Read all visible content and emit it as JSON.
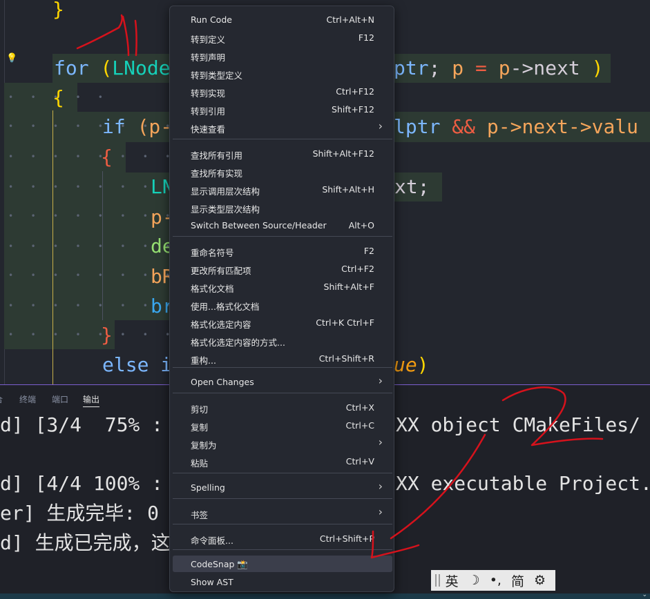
{
  "editor": {
    "lines": {
      "l0": "}",
      "l1a": "for",
      "l1b": "(",
      "l1c": "LNode",
      "l1d": "ptr",
      "l1e": ";",
      "l1f": "p",
      "l1g": "=",
      "l1h": "p",
      "l1i": "->next",
      "l1j": ")",
      "l2": "{",
      "l3a": "if",
      "l3b": "(p-",
      "l3c": "lptr",
      "l3d": "&&",
      "l3e": "p->next->valu",
      "l4": "{",
      "l5a": "LN",
      "l5b": "xt;",
      "l6": "p-",
      "l7": "de",
      "l8": "bR",
      "l9": "br",
      "l10": "}",
      "l11a": "else i",
      "l11b": "ue",
      "l11c": ")"
    }
  },
  "panel": {
    "tabs": [
      "合",
      "终端",
      "端口",
      "输出"
    ],
    "active_tab": "输出",
    "output": {
      "o1a": "d] [3/4  75% :",
      "o1b": "XX object CMakeFiles/",
      "o2a": "d] [4/4 100% :",
      "o2b": "XX executable Project.",
      "o3a": "er] 生成完毕: 0",
      "o4a": "d] 生成已完成，这"
    }
  },
  "ime": {
    "items": [
      "英",
      "☽",
      "•,",
      "简",
      "⚙"
    ]
  },
  "menu": {
    "groups": [
      [
        {
          "label": "Run Code",
          "key": "Ctrl+Alt+N"
        },
        {
          "label": "转到定义",
          "key": "F12"
        },
        {
          "label": "转到声明",
          "key": ""
        },
        {
          "label": "转到类型定义",
          "key": ""
        },
        {
          "label": "转到实现",
          "key": "Ctrl+F12"
        },
        {
          "label": "转到引用",
          "key": "Shift+F12"
        },
        {
          "label": "快速查看",
          "key": "",
          "submenu": true
        }
      ],
      [
        {
          "label": "查找所有引用",
          "key": "Shift+Alt+F12"
        },
        {
          "label": "查找所有实现",
          "key": ""
        },
        {
          "label": "显示调用层次结构",
          "key": "Shift+Alt+H"
        },
        {
          "label": "显示类型层次结构",
          "key": ""
        },
        {
          "label": "Switch Between Source/Header",
          "key": "Alt+O"
        }
      ],
      [
        {
          "label": "重命名符号",
          "key": "F2"
        },
        {
          "label": "更改所有匹配项",
          "key": "Ctrl+F2"
        },
        {
          "label": "格式化文档",
          "key": "Shift+Alt+F"
        },
        {
          "label": "使用...格式化文档",
          "key": ""
        },
        {
          "label": "格式化选定内容",
          "key": "Ctrl+K Ctrl+F"
        },
        {
          "label": "格式化选定内容的方式...",
          "key": ""
        },
        {
          "label": "重构...",
          "key": "Ctrl+Shift+R"
        }
      ],
      [
        {
          "label": "Open Changes",
          "key": "",
          "submenu": true
        }
      ],
      [
        {
          "label": "剪切",
          "key": "Ctrl+X"
        },
        {
          "label": "复制",
          "key": "Ctrl+C"
        },
        {
          "label": "复制为",
          "key": "",
          "submenu": true
        },
        {
          "label": "粘贴",
          "key": "Ctrl+V"
        }
      ],
      [
        {
          "label": "Spelling",
          "key": "",
          "submenu": true
        }
      ],
      [
        {
          "label": "书签",
          "key": "",
          "submenu": true
        }
      ],
      [
        {
          "label": "命令面板...",
          "key": "Ctrl+Shift+P"
        }
      ],
      [
        {
          "label": "CodeSnap 📸",
          "key": "",
          "hover": true
        },
        {
          "label": "Show AST",
          "key": ""
        }
      ]
    ]
  },
  "colors": {
    "menu_bg": "#252830",
    "editor_bg": "#23262e",
    "selection_bg": "#2d3a33",
    "annotation_red": "#d6121c",
    "panel_border": "#7c5fd0"
  }
}
